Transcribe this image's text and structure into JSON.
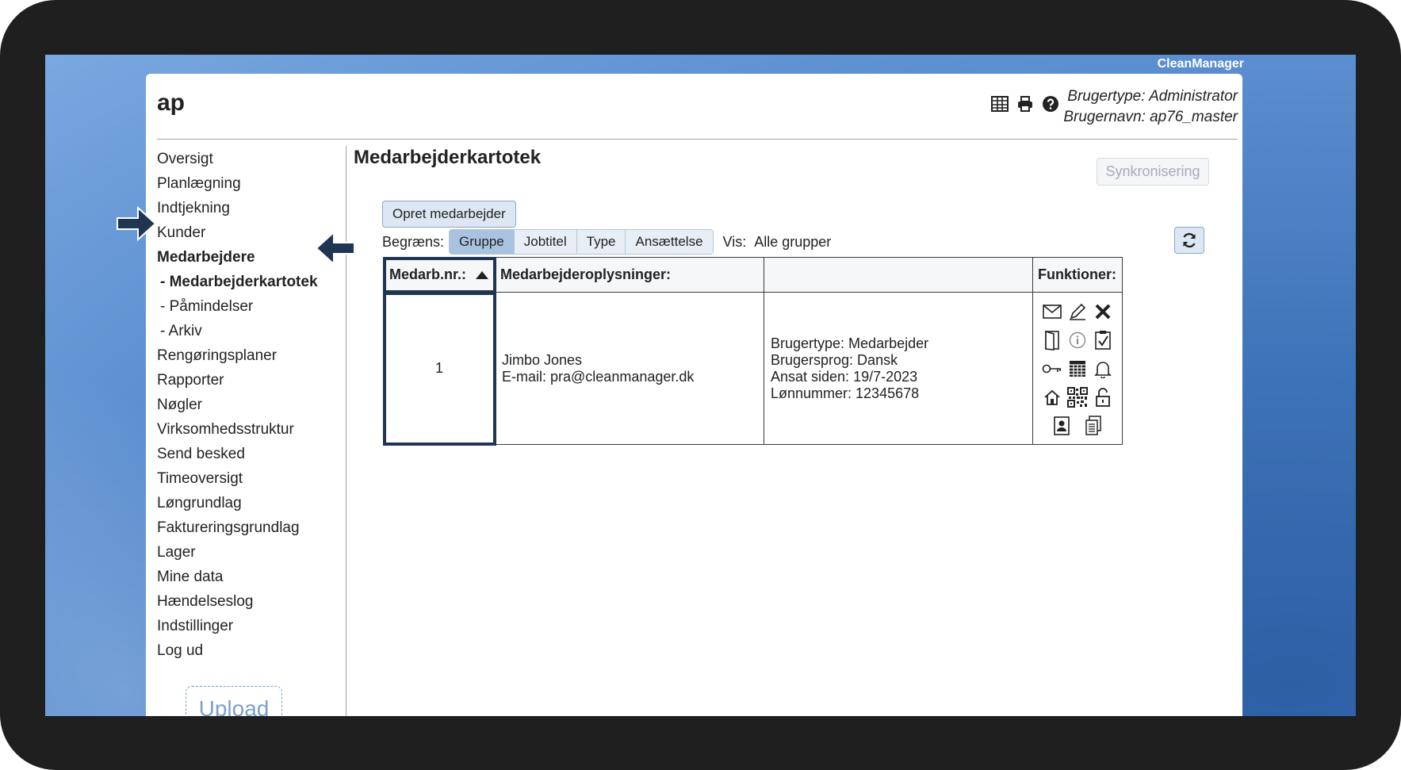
{
  "brand": "CleanManager",
  "app": {
    "title": "ap"
  },
  "user": {
    "type_line": "Brugertype: Administrator",
    "name_line": "Brugernavn: ap76_master"
  },
  "nav": {
    "items": [
      {
        "label": "Oversigt"
      },
      {
        "label": "Planlægning"
      },
      {
        "label": "Indtjekning"
      },
      {
        "label": "Kunder"
      },
      {
        "label": "Medarbejdere"
      },
      {
        "label": "- Medarbejderkartotek"
      },
      {
        "label": "- Påmindelser"
      },
      {
        "label": "- Arkiv"
      },
      {
        "label": "Rengøringsplaner"
      },
      {
        "label": "Rapporter"
      },
      {
        "label": "Nøgler"
      },
      {
        "label": "Virksomhedsstruktur"
      },
      {
        "label": "Send besked"
      },
      {
        "label": "Timeoversigt"
      },
      {
        "label": "Løngrundlag"
      },
      {
        "label": "Faktureringsgrundlag"
      },
      {
        "label": "Lager"
      },
      {
        "label": "Mine data"
      },
      {
        "label": "Hændelseslog"
      },
      {
        "label": "Indstillinger"
      },
      {
        "label": "Log ud"
      }
    ],
    "upload_label": "Upload"
  },
  "main": {
    "title": "Medarbejderkartotek",
    "sync_label": "Synkronisering",
    "create_label": "Opret medarbejder",
    "filter": {
      "label": "Begræns:",
      "options": [
        "Gruppe",
        "Jobtitel",
        "Type",
        "Ansættelse"
      ],
      "active": "Gruppe",
      "vis_label": "Vis:",
      "vis_value": "Alle grupper"
    },
    "table": {
      "headers": [
        "Medarb.nr.:",
        "Medarbejderoplysninger:",
        "",
        "Funktioner:"
      ],
      "rows": [
        {
          "nr": "1",
          "name": "Jimbo Jones",
          "email": "E-mail: pra@cleanmanager.dk",
          "usertype": "Brugertype: Medarbejder",
          "language": "Brugersprog: Dansk",
          "since": "Ansat siden: 19/7-2023",
          "salary_no": "Lønnummer: 12345678"
        }
      ]
    },
    "function_icons": [
      "mail-icon",
      "edit-icon",
      "delete-icon",
      "door-icon",
      "info-icon",
      "checklist-icon",
      "key-icon",
      "calculator-icon",
      "bell-icon",
      "home-icon",
      "qr-code-icon",
      "unlock-icon",
      "id-card-icon",
      "documents-icon"
    ]
  },
  "colors": {
    "accent_navy": "#1f3552",
    "active_tab": "#a9c2e0",
    "button_bg": "#dce7f3"
  }
}
